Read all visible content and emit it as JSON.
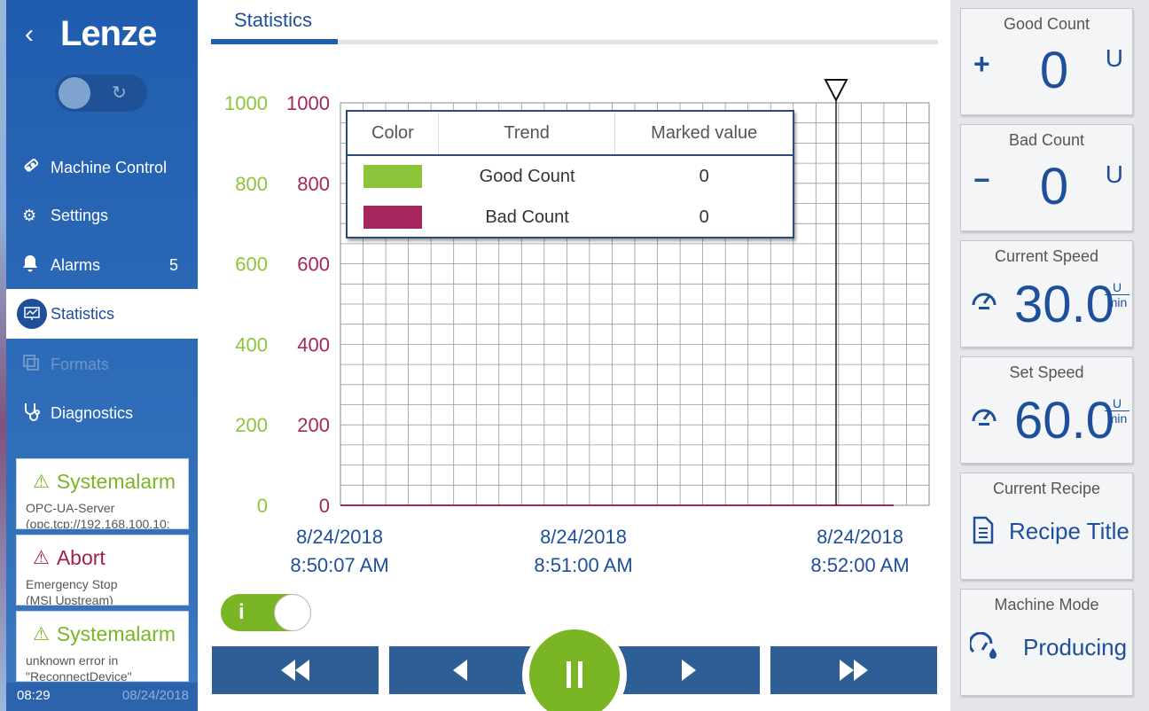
{
  "sidebar": {
    "logo": "Lenze",
    "back_icon": "chevron-left-icon",
    "items": [
      {
        "label": "Machine Control",
        "icon": "machine-control-icon",
        "badge": ""
      },
      {
        "label": "Settings",
        "icon": "gears-icon",
        "badge": ""
      },
      {
        "label": "Alarms",
        "icon": "bell-icon",
        "badge": "5"
      },
      {
        "label": "Statistics",
        "icon": "chart-monitor-icon",
        "badge": "",
        "active": true
      },
      {
        "label": "Formats",
        "icon": "copy-icon",
        "badge": "",
        "disabled": true
      },
      {
        "label": "Diagnostics",
        "icon": "stethoscope-icon",
        "badge": ""
      }
    ],
    "alarms": [
      {
        "title": "Systemalarm",
        "line1": "OPC-UA-Server",
        "line2": "(opc.tcp://192.168.100.10:",
        "severity": "warning"
      },
      {
        "title": "Abort",
        "line1": "Emergency Stop",
        "line2": "(MSI Upstream)",
        "severity": "error"
      },
      {
        "title": "Systemalarm",
        "line1": "unknown error in",
        "line2": "\"ReconnectDevice\"",
        "severity": "warning"
      }
    ],
    "status_time": "08:29",
    "status_date": "08/24/2018"
  },
  "page": {
    "tab_title": "Statistics"
  },
  "legend": {
    "headers": [
      "Color",
      "Trend",
      "Marked value"
    ],
    "rows": [
      {
        "trend": "Good Count",
        "marked_value": "0",
        "color": "#8cc43a"
      },
      {
        "trend": "Bad Count",
        "marked_value": "0",
        "color": "#a4265c"
      }
    ]
  },
  "chart_data": {
    "type": "line",
    "left_axis_color": "#8cc43a",
    "right_axis_color": "#a4265c",
    "y_ticks": [
      0,
      200,
      400,
      600,
      800,
      1000
    ],
    "ylim": [
      0,
      1000
    ],
    "x_labels": [
      {
        "date": "8/24/2018",
        "time": "8:50:07 AM"
      },
      {
        "date": "8/24/2018",
        "time": "8:51:00 AM"
      },
      {
        "date": "8/24/2018",
        "time": "8:52:00 AM"
      }
    ],
    "series": [
      {
        "name": "Good Count",
        "values": [
          0,
          0,
          0
        ]
      },
      {
        "name": "Bad Count",
        "values": [
          0,
          0,
          0
        ]
      }
    ],
    "grid": true,
    "marker": "cursor-triangle"
  },
  "controls": {
    "info_label": "i",
    "buttons": [
      "fast-rewind-icon",
      "step-back-icon",
      "pause-icon",
      "step-forward-icon",
      "fast-forward-icon"
    ]
  },
  "cards": [
    {
      "title": "Good Count",
      "sign": "+",
      "value": "0",
      "unit": "U"
    },
    {
      "title": "Bad Count",
      "sign": "−",
      "value": "0",
      "unit": "U"
    },
    {
      "title": "Current Speed",
      "value": "30.0",
      "unit_num": "U",
      "unit_den": "min",
      "icon": "speedometer-icon"
    },
    {
      "title": "Set Speed",
      "value": "60.0",
      "unit_num": "U",
      "unit_den": "min",
      "icon": "speedometer-icon"
    },
    {
      "title": "Current Recipe",
      "value": "Recipe Title",
      "icon": "document-icon"
    },
    {
      "title": "Machine Mode",
      "value": "Producing",
      "icon": "gauge-drop-icon"
    }
  ]
}
